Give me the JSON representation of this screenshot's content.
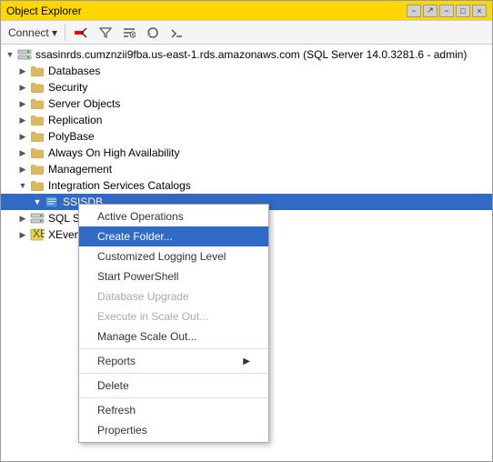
{
  "window": {
    "title": "Object Explorer",
    "controls": {
      "minimize": "−",
      "restore": "□",
      "close": "×",
      "pin": "−",
      "unpin": "↗"
    }
  },
  "toolbar": {
    "connect_label": "Connect ▾",
    "disconnect_icon": "disconnect",
    "filter_icon": "filter",
    "refresh_icon": "refresh",
    "sqlcmd_icon": "sqlcmd"
  },
  "tree": {
    "server": "ssasinrds.cumznzii9fba.us-east-1.rds.amazonaws.com (SQL Server 14.0.3281.6 - admin)",
    "items": [
      {
        "label": "Databases",
        "indent": 1,
        "type": "folder"
      },
      {
        "label": "Security",
        "indent": 1,
        "type": "folder"
      },
      {
        "label": "Server Objects",
        "indent": 1,
        "type": "folder"
      },
      {
        "label": "Replication",
        "indent": 1,
        "type": "folder"
      },
      {
        "label": "PolyBase",
        "indent": 1,
        "type": "folder"
      },
      {
        "label": "Always On High Availability",
        "indent": 1,
        "type": "folder"
      },
      {
        "label": "Management",
        "indent": 1,
        "type": "folder"
      },
      {
        "label": "Integration Services Catalogs",
        "indent": 1,
        "type": "folder"
      },
      {
        "label": "SSISDB",
        "indent": 2,
        "type": "ssisdb",
        "selected": true
      },
      {
        "label": "SQL S...",
        "indent": 1,
        "type": "server2"
      },
      {
        "label": "XEven...",
        "indent": 1,
        "type": "xevent"
      }
    ]
  },
  "context_menu": {
    "items": [
      {
        "label": "Active Operations",
        "type": "item"
      },
      {
        "label": "Create Folder...",
        "type": "item",
        "highlighted": true
      },
      {
        "label": "Customized Logging Level",
        "type": "item"
      },
      {
        "label": "Start PowerShell",
        "type": "item"
      },
      {
        "label": "Database Upgrade",
        "type": "item",
        "disabled": true
      },
      {
        "label": "Execute in Scale Out...",
        "type": "item",
        "disabled": true
      },
      {
        "label": "Manage Scale Out...",
        "type": "item"
      },
      {
        "label": "sep1",
        "type": "separator"
      },
      {
        "label": "Reports",
        "type": "item",
        "has_arrow": true
      },
      {
        "label": "sep2",
        "type": "separator"
      },
      {
        "label": "Delete",
        "type": "item"
      },
      {
        "label": "sep3",
        "type": "separator"
      },
      {
        "label": "Refresh",
        "type": "item"
      },
      {
        "label": "Properties",
        "type": "item"
      }
    ]
  }
}
